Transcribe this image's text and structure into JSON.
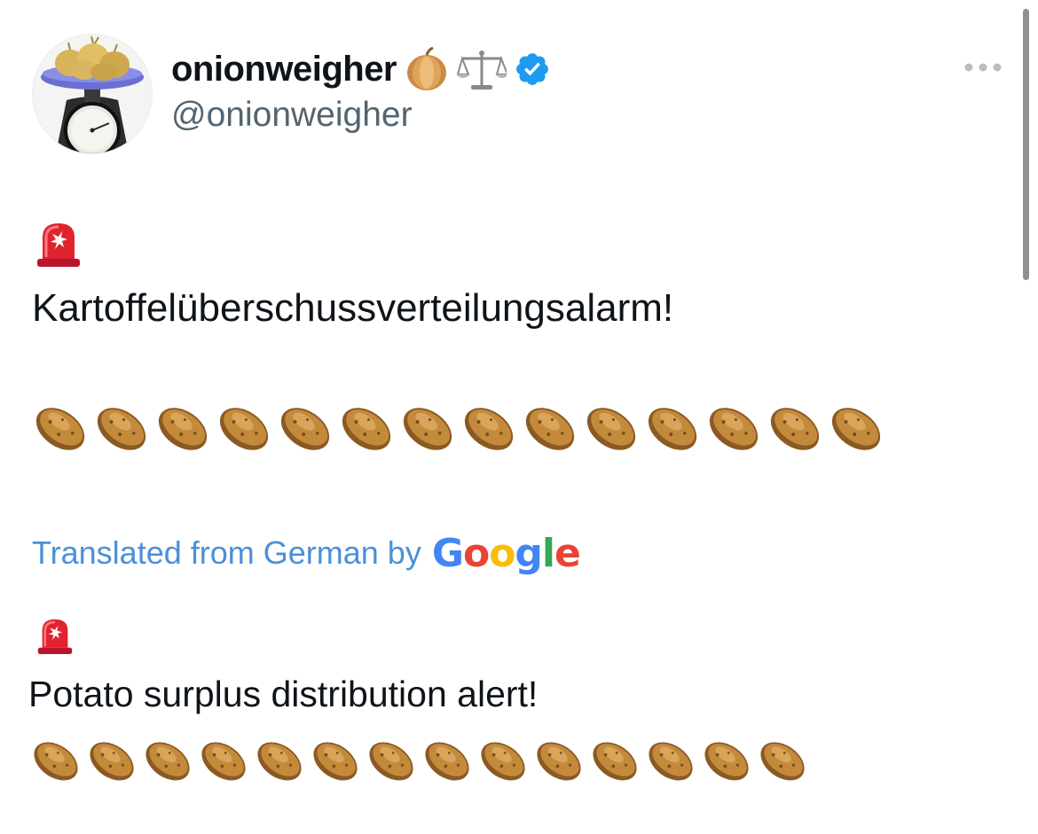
{
  "author": {
    "display_name": "onionweigher",
    "handle": "@onionweigher",
    "name_emojis": [
      "onion-emoji",
      "balance-scale-emoji"
    ],
    "verified": true,
    "verified_color": "#1d9bf0"
  },
  "menu": {
    "icon": "more-horizontal-icon"
  },
  "tweet": {
    "original_text": "Kartoffelüberschussverteilungsalarm!",
    "original_potato_count": 14,
    "translation_label": "Translated from German by",
    "translation_provider": "Google",
    "translated_text": "Potato surplus distribution alert!",
    "translated_potato_count": 14
  },
  "colors": {
    "text_primary": "#0f1419",
    "text_secondary": "#536471",
    "link": "#4a90d9"
  }
}
